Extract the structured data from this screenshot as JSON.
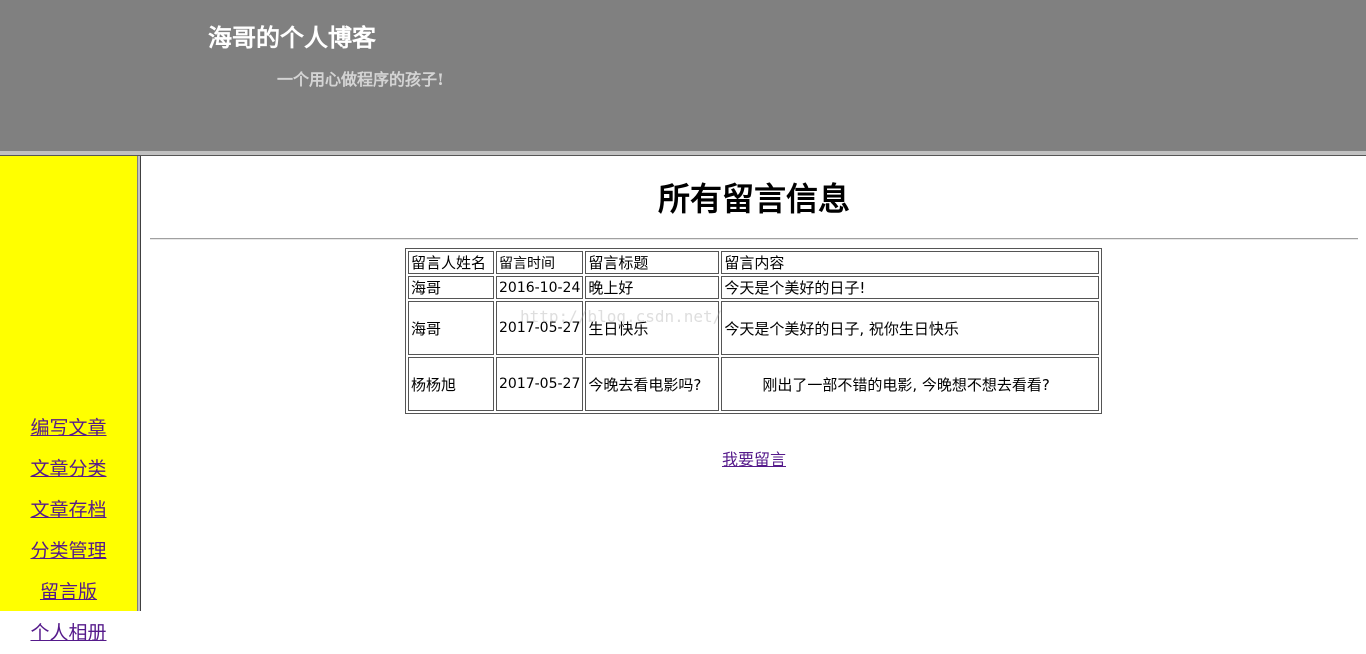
{
  "header": {
    "title": "海哥的个人博客",
    "subtitle": "一个用心做程序的孩子!"
  },
  "sidebar": {
    "items": [
      {
        "label": "编写文章"
      },
      {
        "label": "文章分类"
      },
      {
        "label": "文章存档"
      },
      {
        "label": "分类管理"
      },
      {
        "label": "留言版"
      },
      {
        "label": "个人相册"
      }
    ]
  },
  "main": {
    "title": "所有留言信息",
    "table": {
      "headers": [
        "留言人姓名",
        "留言时间",
        "留言标题",
        "留言内容"
      ],
      "rows": [
        [
          "海哥",
          "2016-10-24",
          "晚上好",
          "今天是个美好的日子!"
        ],
        [
          "海哥",
          "2017-05-27",
          "生日快乐",
          "今天是个美好的日子, 祝你生日快乐"
        ],
        [
          "杨杨旭",
          "2017-05-27",
          "今晚去看电影吗?",
          "刚出了一部不错的电影, 今晚想不想去看看?"
        ]
      ]
    },
    "leave_message_link": "我要留言"
  },
  "watermark": "http://blog.csdn.net/",
  "colors": {
    "header_bg": "#808080",
    "sidebar_bg": "#ffff00",
    "link": "#551a8b"
  }
}
